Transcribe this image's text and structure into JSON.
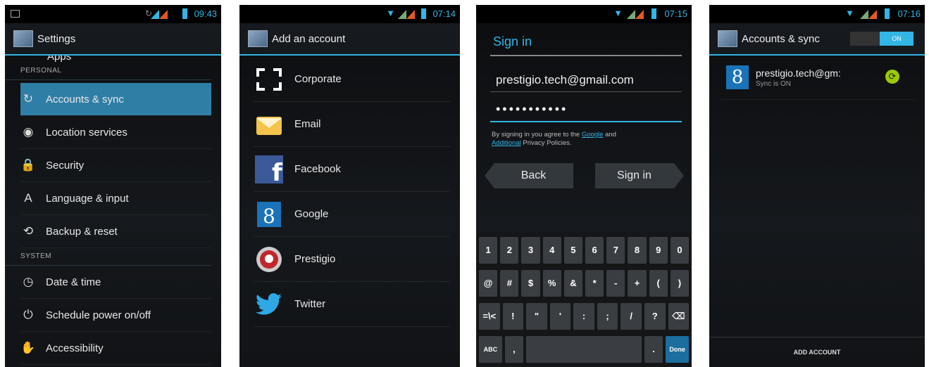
{
  "s1": {
    "time": "09:43",
    "title": "Settings",
    "partial_top": "Apps",
    "cat_personal": "PERSONAL",
    "items_personal": [
      {
        "label": "Accounts & sync",
        "icon": "sync-icon"
      },
      {
        "label": "Location services",
        "icon": "location-icon"
      },
      {
        "label": "Security",
        "icon": "lock-icon"
      },
      {
        "label": "Language & input",
        "icon": "keyboard-icon"
      },
      {
        "label": "Backup & reset",
        "icon": "backup-icon"
      }
    ],
    "cat_system": "SYSTEM",
    "items_system": [
      {
        "label": "Date & time",
        "icon": "clock-icon"
      },
      {
        "label": "Schedule power on/off",
        "icon": "power-icon"
      },
      {
        "label": "Accessibility",
        "icon": "accessibility-icon"
      }
    ]
  },
  "s2": {
    "time": "07:14",
    "title": "Add an account",
    "items": [
      {
        "label": "Corporate",
        "icon": "corporate-icon"
      },
      {
        "label": "Email",
        "icon": "email-icon"
      },
      {
        "label": "Facebook",
        "icon": "facebook-icon"
      },
      {
        "label": "Google",
        "icon": "google-icon"
      },
      {
        "label": "Prestigio",
        "icon": "prestigio-icon"
      },
      {
        "label": "Twitter",
        "icon": "twitter-icon"
      }
    ]
  },
  "s3": {
    "time": "07:15",
    "title": "Sign in",
    "email": "prestigio.tech@gmail.com",
    "password": "•••••••••••",
    "terms_1": "By signing in you agree to the ",
    "terms_link1": "Google",
    "terms_2": " and",
    "terms_link2": "Additional",
    "terms_3": " Privacy Policies.",
    "back": "Back",
    "signin": "Sign in",
    "row1": [
      "1",
      "2",
      "3",
      "4",
      "5",
      "6",
      "7",
      "8",
      "9",
      "0"
    ],
    "row2": [
      "@",
      "#",
      "$",
      "%",
      "&",
      "*",
      "-",
      "+",
      "(",
      ")"
    ],
    "row3": [
      "=\\<",
      "!",
      "\"",
      "'",
      ":",
      ";",
      "/",
      "?",
      "⌫"
    ],
    "abc": "ABC",
    "comma": ",",
    "period": ".",
    "done": "Done"
  },
  "s4": {
    "time": "07:16",
    "title": "Accounts & sync",
    "toggle": "ON",
    "account": "prestigio.tech@gm:",
    "sync_status": "Sync is ON",
    "add_account": "ADD ACCOUNT"
  },
  "colors": {
    "accent": "#33b5e5",
    "selected": "#2f7ea6",
    "sync": "#99cc00"
  }
}
